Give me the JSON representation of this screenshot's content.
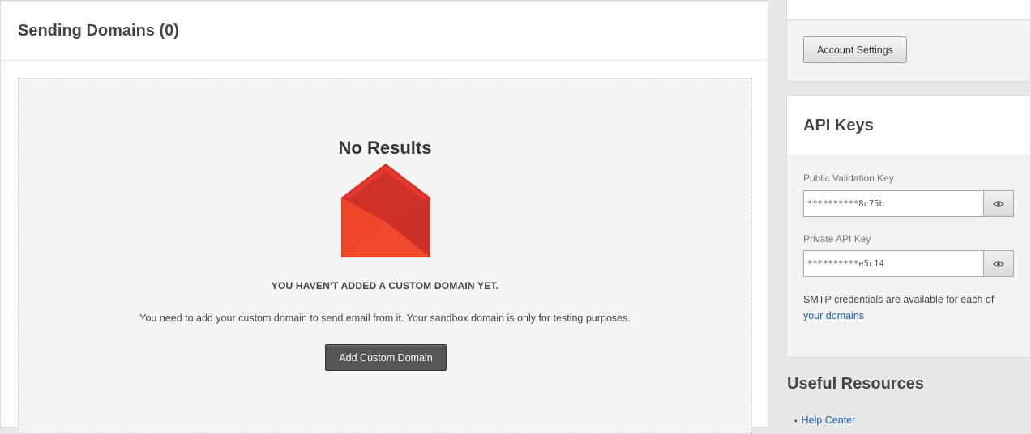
{
  "main": {
    "title": "Sending Domains (0)",
    "empty_state": {
      "title": "No Results",
      "heading": "YOU HAVEN'T ADDED A CUSTOM DOMAIN YET.",
      "description": "You need to add your custom domain to send email from it. Your sandbox domain is only for testing purposes.",
      "button_label": "Add Custom Domain",
      "icon": "envelope-icon"
    }
  },
  "sidebar": {
    "account_settings_label": "Account Settings",
    "api_keys": {
      "title": "API Keys",
      "public_label": "Public Validation Key",
      "public_value": "**********8c75b",
      "private_label": "Private API Key",
      "private_value": "**********e5c14",
      "smtp_note_prefix": "SMTP credentials are available for each of ",
      "smtp_note_link": "your domains",
      "eye_icon": "eye-icon"
    },
    "resources": {
      "title": "Useful Resources",
      "items": [
        {
          "label": "Help Center"
        }
      ]
    }
  },
  "colors": {
    "envelope_red": "#e8432d",
    "link": "#1a5ea8",
    "dark_button": "#555555"
  }
}
